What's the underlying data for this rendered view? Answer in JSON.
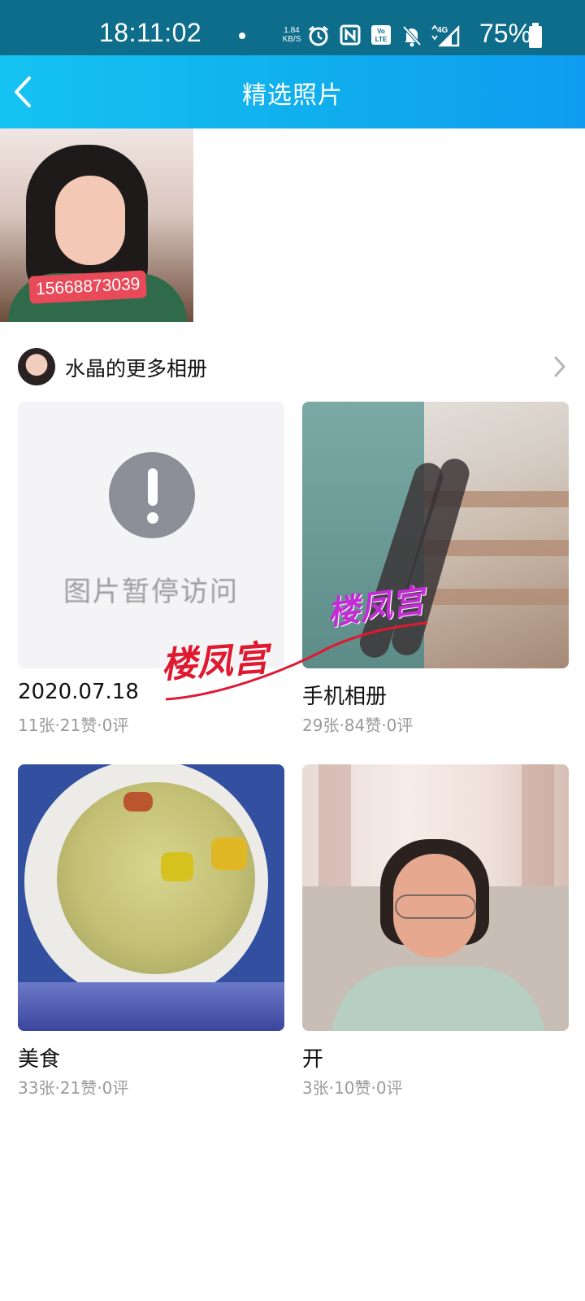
{
  "status_bar": {
    "time": "18:11:02",
    "speed_value": "1.84",
    "speed_unit": "KB/S",
    "battery_percent": "75%",
    "icons": [
      "alarm-icon",
      "nfc-icon",
      "volte-icon",
      "mute-icon",
      "signal-4g-icon",
      "battery-icon"
    ]
  },
  "nav": {
    "back_icon": "chevron-left-icon",
    "title": "精选照片"
  },
  "featured": {
    "phone_tag": "15668873039"
  },
  "owner": {
    "albums_title": "水晶的更多相册"
  },
  "albums": [
    {
      "name": "2020.07.18",
      "meta": "11张·21赞·0评",
      "cover_status": "图片暂停访问"
    },
    {
      "name": "手机相册",
      "meta": "29张·84赞·0评"
    },
    {
      "name": "美食",
      "meta": "33张·21赞·0评"
    },
    {
      "name": "开",
      "meta": "3张·10赞·0评"
    }
  ],
  "watermark": {
    "left": "楼凤宫",
    "right": "楼凤宫"
  },
  "colors": {
    "status_bar": "#0d6d8a",
    "nav_start": "#15c3f2",
    "nav_end": "#0f9cf0",
    "meta_text": "#9a9a9a",
    "watermark_red": "#e01830",
    "watermark_purple": "#c52ad6"
  }
}
